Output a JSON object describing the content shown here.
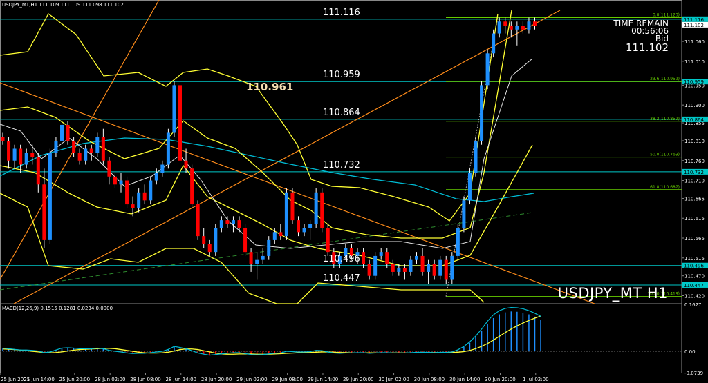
{
  "header": {
    "main": "USDJPY_MT,H1  111.109 111.109 111.098 111.102",
    "macd": "MACD(12,26,9) 0.1515 0.1281 0.0234 0.0000"
  },
  "info": {
    "time_label": "TIME REMAIN",
    "time_value": "00:56:06",
    "bid_label": "Bid",
    "bid_value": "111.102"
  },
  "symbol_title": "USDJPY_MT H1",
  "max_label": "110.961",
  "levels": [
    {
      "text": "111.116",
      "price": 111.116,
      "color": "#00c8c8"
    },
    {
      "text": "110.959",
      "price": 110.959,
      "color": "#00c8c8"
    },
    {
      "text": "110.864",
      "price": 110.864,
      "color": "#00c8c8"
    },
    {
      "text": "110.732",
      "price": 110.732,
      "color": "#00c8c8"
    },
    {
      "text": "110.496",
      "price": 110.496,
      "color": "#00c8c8"
    },
    {
      "text": "110.447",
      "price": 110.447,
      "color": "#00c8c8"
    }
  ],
  "fib": [
    {
      "text": "0.0(111.120)",
      "price": 111.12
    },
    {
      "text": "23.6(110.959)",
      "price": 110.959
    },
    {
      "text": "38.2(110.859)",
      "price": 110.859
    },
    {
      "text": "50.0(110.769)",
      "price": 110.769
    },
    {
      "text": "61.8(110.687)",
      "price": 110.687
    },
    {
      "text": "100.0(110.418)",
      "price": 110.418
    }
  ],
  "axis": {
    "price_ticks": [
      "111.060",
      "111.010",
      "110.950",
      "110.900",
      "110.855",
      "110.810",
      "110.760",
      "110.710",
      "110.665",
      "110.615",
      "110.565",
      "110.515",
      "110.470",
      "110.420"
    ],
    "tick_values": [
      111.06,
      111.01,
      110.95,
      110.9,
      110.855,
      110.81,
      110.76,
      110.71,
      110.665,
      110.615,
      110.565,
      110.515,
      110.47,
      110.42
    ],
    "price_tags": [
      {
        "text": "111.116",
        "price": 111.116,
        "bg": "#00c8c8",
        "fg": "#000"
      },
      {
        "text": "111.102",
        "price": 111.102,
        "bg": "#ffffff",
        "fg": "#000"
      },
      {
        "text": "110.959",
        "price": 110.959,
        "bg": "#00c8c8",
        "fg": "#000"
      },
      {
        "text": "110.864",
        "price": 110.864,
        "bg": "#00c8c8",
        "fg": "#000"
      },
      {
        "text": "110.732",
        "price": 110.732,
        "bg": "#00c8c8",
        "fg": "#000"
      },
      {
        "text": "110.496",
        "price": 110.496,
        "bg": "#00c8c8",
        "fg": "#000"
      },
      {
        "text": "110.447",
        "price": 110.447,
        "bg": "#00c8c8",
        "fg": "#000"
      }
    ],
    "macd_ticks": [
      {
        "text": "0.1627",
        "value": 0.1627
      },
      {
        "text": "0.00",
        "value": 0.0
      },
      {
        "text": "-0.0739",
        "value": -0.0739
      }
    ],
    "time_ticks": [
      {
        "text": "25 Jun 2021",
        "bar": 0
      },
      {
        "text": "25 Jun 14:00",
        "bar": 6.5
      },
      {
        "text": "25 Jun 20:00",
        "bar": 12.5
      },
      {
        "text": "28 Jun 02:00",
        "bar": 18.5
      },
      {
        "text": "28 Jun 08:00",
        "bar": 24.5
      },
      {
        "text": "28 Jun 14:00",
        "bar": 30.5
      },
      {
        "text": "28 Jun 20:00",
        "bar": 36.5
      },
      {
        "text": "29 Jun 02:00",
        "bar": 42.5
      },
      {
        "text": "29 Jun 08:00",
        "bar": 48.5
      },
      {
        "text": "29 Jun 14:00",
        "bar": 54.5
      },
      {
        "text": "29 Jun 20:00",
        "bar": 60.5
      },
      {
        "text": "30 Jun 02:00",
        "bar": 66.5
      },
      {
        "text": "30 Jun 08:00",
        "bar": 72.5
      },
      {
        "text": "30 Jun 14:00",
        "bar": 78.5
      },
      {
        "text": "30 Jun 20:00",
        "bar": 84.5
      },
      {
        "text": "1 Jul 02:00",
        "bar": 90.5
      }
    ]
  },
  "colors": {
    "bull": "#1e90ff",
    "bear": "#ff0000",
    "level": "#00c8c8",
    "fib": "#66cc00",
    "band": "#ffff33",
    "trend": "#ff8c1a",
    "ma": "#00bcd4",
    "macd_hist": "#1e90ff",
    "macd_signal": "#ffff33"
  },
  "chart_data": {
    "type": "candlestick",
    "price_range": [
      110.4,
      111.14
    ],
    "macd_range": [
      -0.0739,
      0.1627
    ],
    "candles": [
      [
        110.82,
        110.83,
        110.8,
        110.81
      ],
      [
        110.81,
        110.82,
        110.74,
        110.76
      ],
      [
        110.76,
        110.8,
        110.74,
        110.79
      ],
      [
        110.79,
        110.8,
        110.73,
        110.75
      ],
      [
        110.75,
        110.79,
        110.74,
        110.78
      ],
      [
        110.78,
        110.8,
        110.75,
        110.77
      ],
      [
        110.77,
        110.78,
        110.68,
        110.7
      ],
      [
        110.7,
        110.74,
        110.54,
        110.56
      ],
      [
        110.56,
        110.79,
        110.55,
        110.78
      ],
      [
        110.78,
        110.82,
        110.77,
        110.81
      ],
      [
        110.81,
        110.86,
        110.8,
        110.85
      ],
      [
        110.85,
        110.86,
        110.8,
        110.81
      ],
      [
        110.81,
        110.82,
        110.77,
        110.78
      ],
      [
        110.78,
        110.79,
        110.75,
        110.76
      ],
      [
        110.76,
        110.8,
        110.75,
        110.79
      ],
      [
        110.79,
        110.8,
        110.76,
        110.78
      ],
      [
        110.78,
        110.83,
        110.77,
        110.82
      ],
      [
        110.82,
        110.84,
        110.75,
        110.76
      ],
      [
        110.76,
        110.77,
        110.7,
        110.72
      ],
      [
        110.72,
        110.73,
        110.69,
        110.7
      ],
      [
        110.7,
        110.73,
        110.68,
        110.71
      ],
      [
        110.71,
        110.72,
        110.64,
        110.65
      ],
      [
        110.65,
        110.67,
        110.62,
        110.64
      ],
      [
        110.64,
        110.69,
        110.63,
        110.68
      ],
      [
        110.68,
        110.7,
        110.65,
        110.66
      ],
      [
        110.66,
        110.72,
        110.65,
        110.71
      ],
      [
        110.71,
        110.74,
        110.7,
        110.73
      ],
      [
        110.73,
        110.76,
        110.72,
        110.75
      ],
      [
        110.75,
        110.84,
        110.74,
        110.83
      ],
      [
        110.83,
        110.96,
        110.82,
        110.95
      ],
      [
        110.95,
        110.96,
        110.75,
        110.76
      ],
      [
        110.76,
        110.79,
        110.73,
        110.74
      ],
      [
        110.74,
        110.75,
        110.64,
        110.65
      ],
      [
        110.65,
        110.66,
        110.56,
        110.57
      ],
      [
        110.57,
        110.59,
        110.54,
        110.55
      ],
      [
        110.55,
        110.56,
        110.52,
        110.53
      ],
      [
        110.53,
        110.6,
        110.52,
        110.59
      ],
      [
        110.59,
        110.62,
        110.58,
        110.61
      ],
      [
        110.61,
        110.62,
        110.59,
        110.6
      ],
      [
        110.6,
        110.62,
        110.58,
        110.61
      ],
      [
        110.61,
        110.62,
        110.58,
        110.59
      ],
      [
        110.59,
        110.6,
        110.52,
        110.53
      ],
      [
        110.53,
        110.54,
        110.48,
        110.5
      ],
      [
        110.5,
        110.53,
        110.46,
        110.51
      ],
      [
        110.51,
        110.54,
        110.5,
        110.52
      ],
      [
        110.52,
        110.57,
        110.51,
        110.56
      ],
      [
        110.56,
        110.59,
        110.55,
        110.58
      ],
      [
        110.58,
        110.6,
        110.56,
        110.57
      ],
      [
        110.57,
        110.69,
        110.56,
        110.68
      ],
      [
        110.68,
        110.69,
        110.6,
        110.61
      ],
      [
        110.61,
        110.62,
        110.57,
        110.58
      ],
      [
        110.58,
        110.6,
        110.57,
        110.59
      ],
      [
        110.59,
        110.61,
        110.56,
        110.6
      ],
      [
        110.6,
        110.69,
        110.59,
        110.68
      ],
      [
        110.68,
        110.69,
        110.58,
        110.59
      ],
      [
        110.59,
        110.6,
        110.52,
        110.53
      ],
      [
        110.53,
        110.54,
        110.49,
        110.5
      ],
      [
        110.5,
        110.53,
        110.49,
        110.52
      ],
      [
        110.52,
        110.55,
        110.51,
        110.54
      ],
      [
        110.54,
        110.55,
        110.51,
        110.52
      ],
      [
        110.52,
        110.54,
        110.5,
        110.53
      ],
      [
        110.53,
        110.54,
        110.49,
        110.5
      ],
      [
        110.5,
        110.51,
        110.46,
        110.47
      ],
      [
        110.47,
        110.53,
        110.46,
        110.52
      ],
      [
        110.52,
        110.54,
        110.51,
        110.53
      ],
      [
        110.53,
        110.54,
        110.49,
        110.5
      ],
      [
        110.5,
        110.51,
        110.47,
        110.48
      ],
      [
        110.48,
        110.5,
        110.47,
        110.49
      ],
      [
        110.49,
        110.5,
        110.46,
        110.48
      ],
      [
        110.48,
        110.52,
        110.47,
        110.51
      ],
      [
        110.51,
        110.53,
        110.5,
        110.52
      ],
      [
        110.52,
        110.54,
        110.47,
        110.48
      ],
      [
        110.48,
        110.51,
        110.45,
        110.5
      ],
      [
        110.5,
        110.51,
        110.46,
        110.47
      ],
      [
        110.47,
        110.52,
        110.46,
        110.51
      ],
      [
        110.51,
        110.52,
        110.45,
        110.46
      ],
      [
        110.46,
        110.53,
        110.45,
        110.52
      ],
      [
        110.52,
        110.6,
        110.51,
        110.59
      ],
      [
        110.59,
        110.67,
        110.58,
        110.66
      ],
      [
        110.66,
        110.74,
        110.65,
        110.73
      ],
      [
        110.73,
        110.82,
        110.72,
        110.81
      ],
      [
        110.81,
        110.96,
        110.8,
        110.95
      ],
      [
        110.95,
        111.04,
        110.94,
        111.03
      ],
      [
        111.03,
        111.09,
        111.02,
        111.08
      ],
      [
        111.08,
        111.12,
        111.07,
        111.11
      ],
      [
        111.11,
        111.12,
        111.08,
        111.1
      ],
      [
        111.1,
        111.11,
        111.07,
        111.09
      ],
      [
        111.09,
        111.11,
        111.05,
        111.1
      ],
      [
        111.1,
        111.11,
        111.08,
        111.09
      ],
      [
        111.09,
        111.12,
        111.08,
        111.11
      ],
      [
        111.11,
        111.12,
        111.09,
        111.1
      ]
    ],
    "macd_hist": [
      0.01,
      0.008,
      0.006,
      0.004,
      0.004,
      0.003,
      0.001,
      -0.004,
      -0.002,
      0.004,
      0.01,
      0.011,
      0.01,
      0.008,
      0.008,
      0.008,
      0.01,
      0.008,
      0.003,
      0.0,
      -0.002,
      -0.005,
      -0.007,
      -0.006,
      -0.006,
      -0.004,
      -0.002,
      0.0,
      0.006,
      0.015,
      0.012,
      0.008,
      0.002,
      -0.005,
      -0.009,
      -0.012,
      -0.01,
      -0.008,
      -0.006,
      -0.004,
      -0.004,
      -0.007,
      -0.01,
      -0.011,
      -0.01,
      -0.008,
      -0.006,
      -0.005,
      0.0,
      -0.001,
      -0.002,
      -0.002,
      -0.001,
      0.003,
      0.002,
      -0.002,
      -0.005,
      -0.006,
      -0.005,
      -0.005,
      -0.004,
      -0.004,
      -0.006,
      -0.005,
      -0.004,
      -0.004,
      -0.005,
      -0.005,
      -0.005,
      -0.004,
      -0.003,
      -0.003,
      -0.003,
      -0.004,
      -0.003,
      -0.003,
      -0.002,
      0.005,
      0.015,
      0.03,
      0.048,
      0.07,
      0.095,
      0.115,
      0.128,
      0.135,
      0.138,
      0.137,
      0.134,
      0.128,
      0.12,
      0.11
    ],
    "macd_signal": [
      0.008,
      0.007,
      0.006,
      0.004,
      0.002,
      0.0,
      -0.002,
      -0.004,
      -0.005,
      -0.004,
      -0.002,
      0.001,
      0.004,
      0.006,
      0.007,
      0.008,
      0.009,
      0.01,
      0.01,
      0.009,
      0.006,
      0.003,
      0.0,
      -0.003,
      -0.005,
      -0.006,
      -0.006,
      -0.005,
      -0.003,
      0.001,
      0.006,
      0.008,
      0.008,
      0.006,
      0.002,
      -0.002,
      -0.006,
      -0.009,
      -0.01,
      -0.01,
      -0.009,
      -0.009,
      -0.009,
      -0.01,
      -0.01,
      -0.01,
      -0.009,
      -0.008,
      -0.007,
      -0.006,
      -0.005,
      -0.004,
      -0.004,
      -0.003,
      -0.002,
      -0.002,
      -0.003,
      -0.004,
      -0.004,
      -0.005,
      -0.005,
      -0.005,
      -0.005,
      -0.005,
      -0.005,
      -0.005,
      -0.005,
      -0.005,
      -0.005,
      -0.005,
      -0.005,
      -0.005,
      -0.004,
      -0.004,
      -0.004,
      -0.004,
      -0.004,
      -0.003,
      -0.001,
      0.003,
      0.009,
      0.017,
      0.027,
      0.039,
      0.052,
      0.065,
      0.077,
      0.088,
      0.098,
      0.107,
      0.115,
      0.122
    ]
  }
}
